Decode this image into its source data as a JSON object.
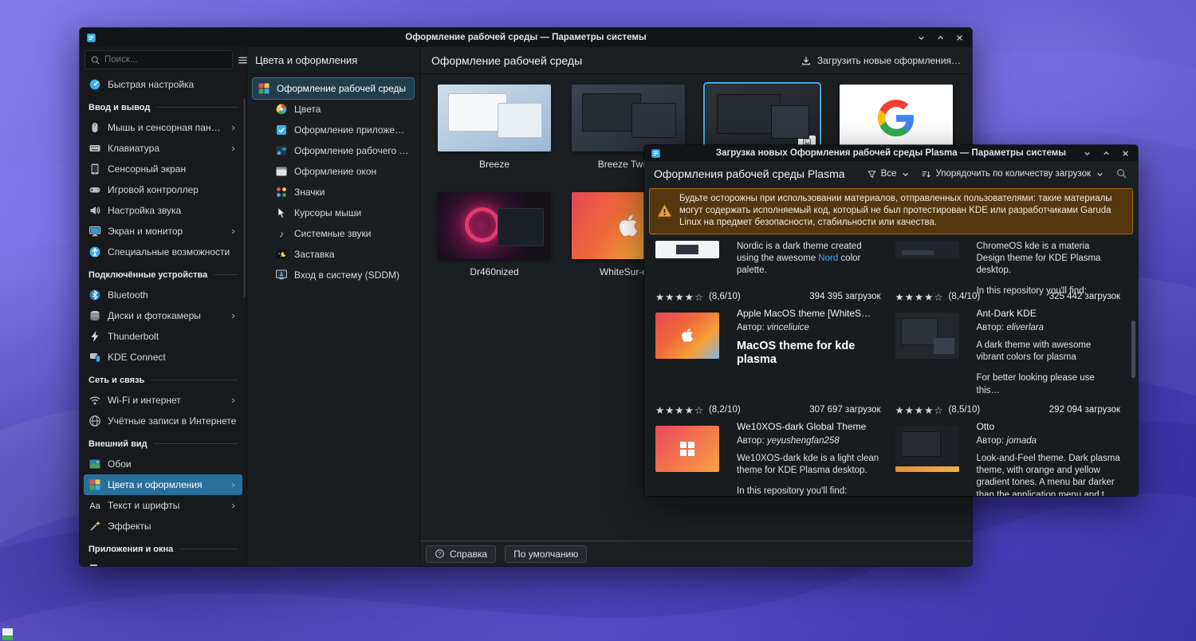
{
  "accent_color": "#3daee9",
  "main_window": {
    "title": "Оформление рабочей среды — Параметры системы",
    "sidebar": {
      "search_placeholder": "Поиск...",
      "items": [
        {
          "type": "item",
          "icon": "quick-settings",
          "label": "Быстрая настройка"
        },
        {
          "type": "section",
          "label": "Ввод и вывод"
        },
        {
          "type": "item",
          "icon": "mouse",
          "label": "Мышь и сенсорная панель",
          "arrow": true
        },
        {
          "type": "item",
          "icon": "keyboard",
          "label": "Клавиатура",
          "arrow": true
        },
        {
          "type": "item",
          "icon": "touchscreen",
          "label": "Сенсорный экран"
        },
        {
          "type": "item",
          "icon": "gamepad",
          "label": "Игровой контроллер"
        },
        {
          "type": "item",
          "icon": "audio",
          "label": "Настройка звука"
        },
        {
          "type": "item",
          "icon": "display",
          "label": "Экран и монитор",
          "arrow": true
        },
        {
          "type": "item",
          "icon": "accessibility",
          "label": "Специальные возможности"
        },
        {
          "type": "section",
          "label": "Подключённые устройства"
        },
        {
          "type": "item",
          "icon": "bluetooth",
          "label": "Bluetooth"
        },
        {
          "type": "item",
          "icon": "disks",
          "label": "Диски и фотокамеры",
          "arrow": true
        },
        {
          "type": "item",
          "icon": "thunderbolt",
          "label": "Thunderbolt"
        },
        {
          "type": "item",
          "icon": "kdeconnect",
          "label": "KDE Connect"
        },
        {
          "type": "section",
          "label": "Сеть и связь"
        },
        {
          "type": "item",
          "icon": "wifi",
          "label": "Wi-Fi и интернет",
          "arrow": true
        },
        {
          "type": "item",
          "icon": "accounts",
          "label": "Учётные записи в Интернете"
        },
        {
          "type": "section",
          "label": "Внешний вид"
        },
        {
          "type": "item",
          "icon": "wallpaper",
          "label": "Обои"
        },
        {
          "type": "item",
          "icon": "colors-themes",
          "label": "Цвета и оформления",
          "arrow": true,
          "selected": true
        },
        {
          "type": "item",
          "icon": "fonts",
          "label": "Текст и шрифты",
          "arrow": true
        },
        {
          "type": "item",
          "icon": "effects",
          "label": "Эффекты"
        },
        {
          "type": "section",
          "label": "Приложения и окна"
        },
        {
          "type": "item",
          "icon": "apps-windows",
          "label": ""
        }
      ]
    },
    "subnav": {
      "header": "Цвета и оформления",
      "items": [
        {
          "icon": "global-theme",
          "label": "Оформление рабочей среды",
          "selected": true,
          "indent": false
        },
        {
          "icon": "color-wheel",
          "label": "Цвета",
          "indent": true
        },
        {
          "icon": "app-style",
          "label": "Оформление приложений",
          "indent": true
        },
        {
          "icon": "plasma-style",
          "label": "Оформление рабочего сто…",
          "indent": true
        },
        {
          "icon": "window-decorations",
          "label": "Оформление окон",
          "indent": true
        },
        {
          "icon": "icons",
          "label": "Значки",
          "indent": true
        },
        {
          "icon": "cursors",
          "label": "Курсоры мыши",
          "indent": true
        },
        {
          "icon": "system-sounds",
          "label": "Системные звуки",
          "indent": true
        },
        {
          "icon": "screen-locking",
          "label": "Заставка",
          "indent": true
        },
        {
          "icon": "sddm",
          "label": "Вход в систему (SDDM)",
          "indent": true
        }
      ]
    },
    "content": {
      "header": "Оформление рабочей среды",
      "download_label": "Загрузить новые оформления…",
      "themes": [
        {
          "name": "Breeze",
          "style": "breeze"
        },
        {
          "name": "Breeze Twili…",
          "style": "twilight"
        },
        {
          "name": "",
          "style": "dark",
          "selected": true,
          "badge": true
        },
        {
          "name": "",
          "style": "google"
        },
        {
          "name": "Dr460nized",
          "style": "dr460"
        },
        {
          "name": "WhiteSur-d…",
          "style": "whitesur"
        }
      ],
      "footer": {
        "help": "Справка",
        "defaults": "По умолчанию"
      }
    }
  },
  "dialog": {
    "title": "Загрузка новых Оформления рабочей среды Plasma — Параметры системы",
    "header": "Оформления рабочей среды Plasma",
    "filter_label": "Все",
    "sort_label": "Упорядочить по количеству загрузок",
    "author_label": "Автор:",
    "warning": "Будьте осторожны при использовании материалов, отправленных пользователями: такие материалы могут содержать исполняемый код, который не был протестирован KDE или разработчиками Garuda Linux на предмет безопасности, стабильности или качества.",
    "entries": [
      {
        "cut": true,
        "thumb": "nordic",
        "desc_before": "Nordic is a dark theme created using the awesome ",
        "desc_link": "Nord",
        "desc_after": " color palette.",
        "stars_filled": "★★★★",
        "stars_empty": "☆",
        "rating": "(8,6/10)",
        "downloads": "394 395 загрузок"
      },
      {
        "cut": true,
        "thumb": "chromeos",
        "desc": "ChromeOS kde is a materia Design theme for KDE Plasma desktop.",
        "extra": "In this repository you'll find:",
        "stars_filled": "★★★★",
        "stars_empty": "☆",
        "rating": "(8,4/10)",
        "downloads": "325 442 загрузок"
      },
      {
        "thumb": "whitesur",
        "name": "Apple MacOS theme [WhiteS…",
        "author": "vinceliuice",
        "headline": "MacOS theme for kde plasma",
        "stars_filled": "★★★★",
        "stars_empty": "☆",
        "rating": "(8,2/10)",
        "downloads": "307 697 загрузок"
      },
      {
        "thumb": "antdark",
        "name": "Ant-Dark KDE",
        "author": "eliverlara",
        "desc": "A dark theme with awesome vibrant colors for plasma",
        "extra": "For better looking please use this…",
        "stars_filled": "★★★★",
        "stars_empty": "☆",
        "rating": "(8,5/10)",
        "downloads": "292 094 загрузок"
      },
      {
        "thumb": "we10x",
        "name": "We10XOS-dark Global Theme",
        "author": "yeyushengfan258",
        "desc": "We10XOS-dark kde is a light clean theme for KDE Plasma desktop.",
        "extra": "In this repository you'll find:"
      },
      {
        "thumb": "otto",
        "name": "Otto",
        "author": "jomada",
        "desc": "Look-and-Feel theme. Dark plasma theme, with orange and yellow gradient tones. A menu bar darker than the application menu and t…"
      }
    ]
  }
}
